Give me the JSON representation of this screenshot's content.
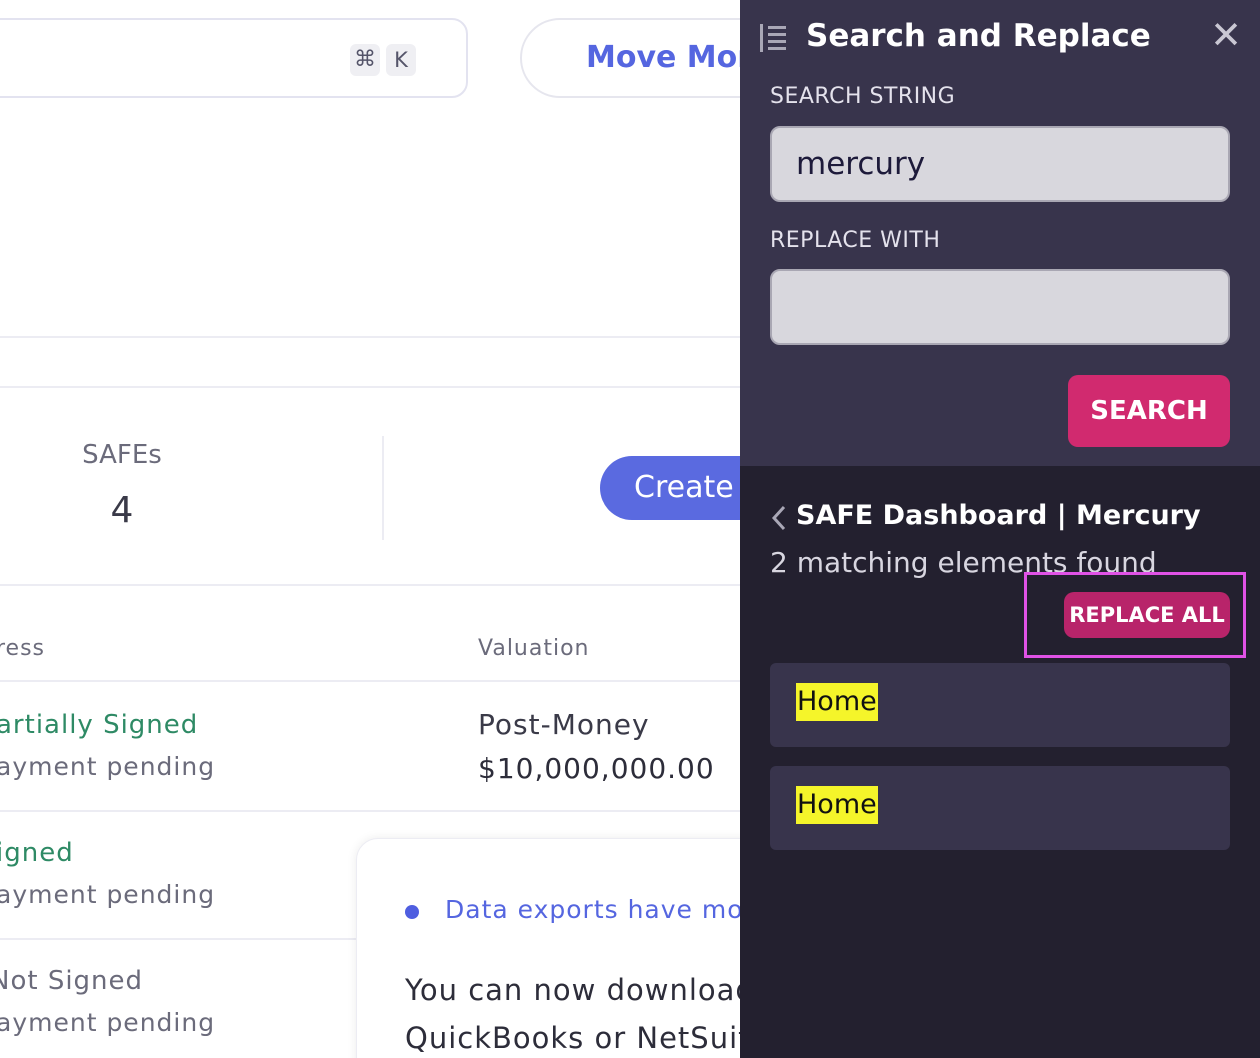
{
  "background": {
    "shortcut_keys": [
      "⌘",
      "K"
    ],
    "move_money_label": "Move Mon",
    "stats": {
      "safes_label": "SAFEs",
      "safes_count": "4"
    },
    "create_label": "Create",
    "table": {
      "columns": [
        "ress",
        "Valuation"
      ],
      "rows": [
        {
          "status": "artially Signed",
          "sub": "ayment pending",
          "valuation_label": "Post-Money",
          "valuation_amount": "$10,000,000.00"
        },
        {
          "status": "igned",
          "sub": "ayment pending"
        },
        {
          "status": "Not Signed",
          "sub": "ayment pending"
        }
      ]
    },
    "notice": {
      "link_text": "Data exports have move",
      "body_line1": "You can now download",
      "body_line2": "QuickBooks or NetSuite"
    }
  },
  "panel": {
    "title": "Search and Replace",
    "close_icon": "close-icon",
    "search_label": "SEARCH STRING",
    "search_value": "mercury",
    "replace_label": "REPLACE WITH",
    "replace_value": "",
    "search_button": "SEARCH",
    "results": {
      "page_title": "SAFE Dashboard | Mercury",
      "count_text": "2 matching elements found",
      "replace_all_button": "REPLACE ALL",
      "matches": [
        "Home",
        "Home"
      ]
    },
    "colors": {
      "accent": "#d12a6f",
      "panel_bg": "#23202f",
      "highlight": "#f5f52a",
      "focus_outline": "#e052e6"
    }
  }
}
